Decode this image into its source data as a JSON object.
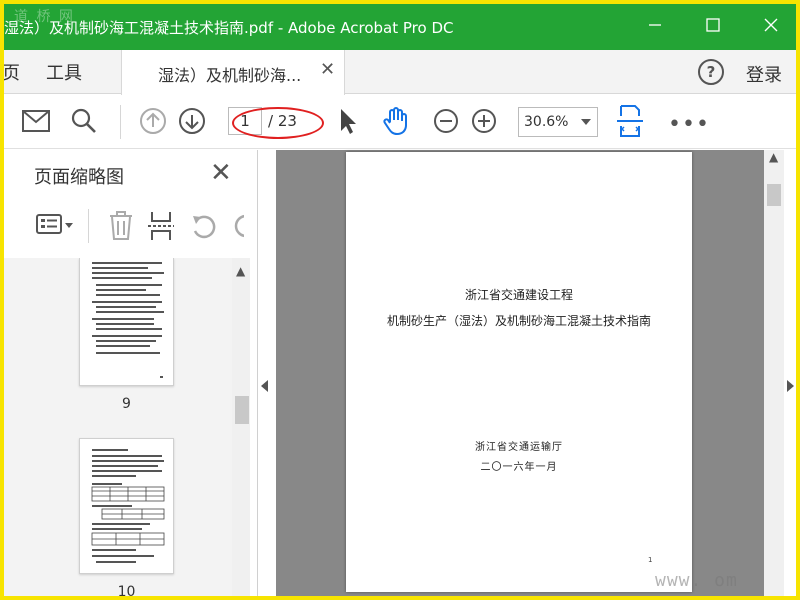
{
  "watermark_top": "道 桥 网",
  "titlebar": {
    "title": "湿法）及机制砂海工混凝土技术指南.pdf - Adobe Acrobat Pro DC",
    "minimize": "—",
    "maximize": "☐",
    "close": "✕"
  },
  "menu": {
    "home": "页",
    "tools": "工具"
  },
  "tab": {
    "label": "湿法）及机制砂海...",
    "close": "✕"
  },
  "header_right": {
    "help": "?",
    "login": "登录"
  },
  "toolbar": {
    "current_page": "1",
    "total_pages": "/ 23",
    "zoom": "30.6%",
    "more": "•••"
  },
  "left_panel": {
    "title": "页面缩略图",
    "close": "✕",
    "thumbnails": [
      {
        "label": "9"
      },
      {
        "label": "10"
      }
    ]
  },
  "document": {
    "line1": "浙江省交通建设工程",
    "line2": "机制砂生产（湿法）及机制砂海工混凝土技术指南",
    "line3": "浙江省交通运输厅",
    "line4": "二〇一六年一月",
    "page_mark": "1"
  },
  "watermark_bottom": "www.        om",
  "colors": {
    "titlebar": "#23a435",
    "frame": "#f7e400",
    "icon_blue": "#1473e6",
    "highlight_oval": "#e02020"
  }
}
